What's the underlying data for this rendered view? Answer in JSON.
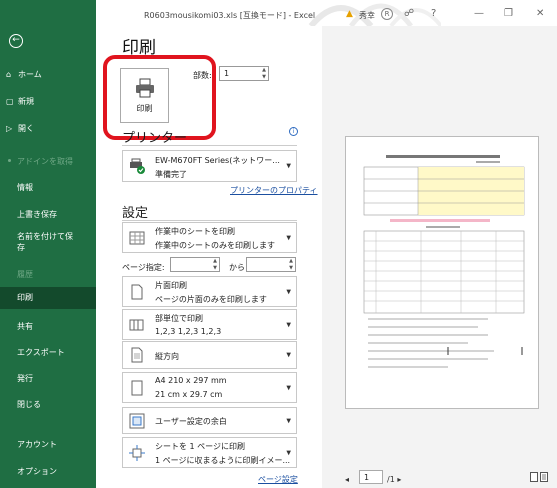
{
  "window": {
    "title": "R0603mousikomi03.xls [互換モード] - Excel",
    "user": "秀幸",
    "user_initial": "R",
    "warning": "▲"
  },
  "sidebar": {
    "back": "←",
    "items": [
      {
        "label": "ホーム",
        "icon": "⌂"
      },
      {
        "label": "新規",
        "icon": "▢"
      },
      {
        "label": "開く",
        "icon": "▷"
      },
      {
        "label": "アドインを取得"
      },
      {
        "label": "情報"
      },
      {
        "label": "上書き保存"
      },
      {
        "label": "名前を付けて保",
        "label2": "存"
      },
      {
        "label": "履歴"
      },
      {
        "label": "印刷"
      },
      {
        "label": "共有"
      },
      {
        "label": "エクスポート"
      },
      {
        "label": "発行"
      },
      {
        "label": "閉じる"
      },
      {
        "label": "アカウント"
      },
      {
        "label": "オプション"
      }
    ]
  },
  "main": {
    "title": "印刷",
    "print_button": "印刷",
    "copies_label": "部数:",
    "copies_value": "1",
    "printer_heading": "プリンター",
    "printer_name": "EW-M670FT Series(ネットワー...",
    "printer_status": "準備完了",
    "printer_props": "プリンターのプロパティ",
    "settings_heading": "設定",
    "sheets_t1": "作業中のシートを印刷",
    "sheets_t2": "作業中のシートのみを印刷します",
    "pages_label": "ページ指定:",
    "pages_to": "から",
    "sides_t1": "片面印刷",
    "sides_t2": "ページの片面のみを印刷します",
    "collate_t1": "部単位で印刷",
    "collate_t2": "1,2,3    1,2,3    1,2,3",
    "orient_t1": "縦方向",
    "paper_t1": "A4 210 x 297 mm",
    "paper_t2": "21 cm x 29.7 cm",
    "margin_t1": "ユーザー設定の余白",
    "scale_t1": "シートを 1 ページに印刷",
    "scale_t2": "1 ページに収まるように印刷イメー...",
    "page_setup": "ページ設定"
  },
  "preview": {
    "page": "1",
    "total": "/1 ▸",
    "prev": "◂"
  },
  "colors": {
    "sidebar": "#1f6e43",
    "sidebar_selected": "#134a2c",
    "highlight": "#e0141e",
    "link": "#1b4fa0"
  }
}
